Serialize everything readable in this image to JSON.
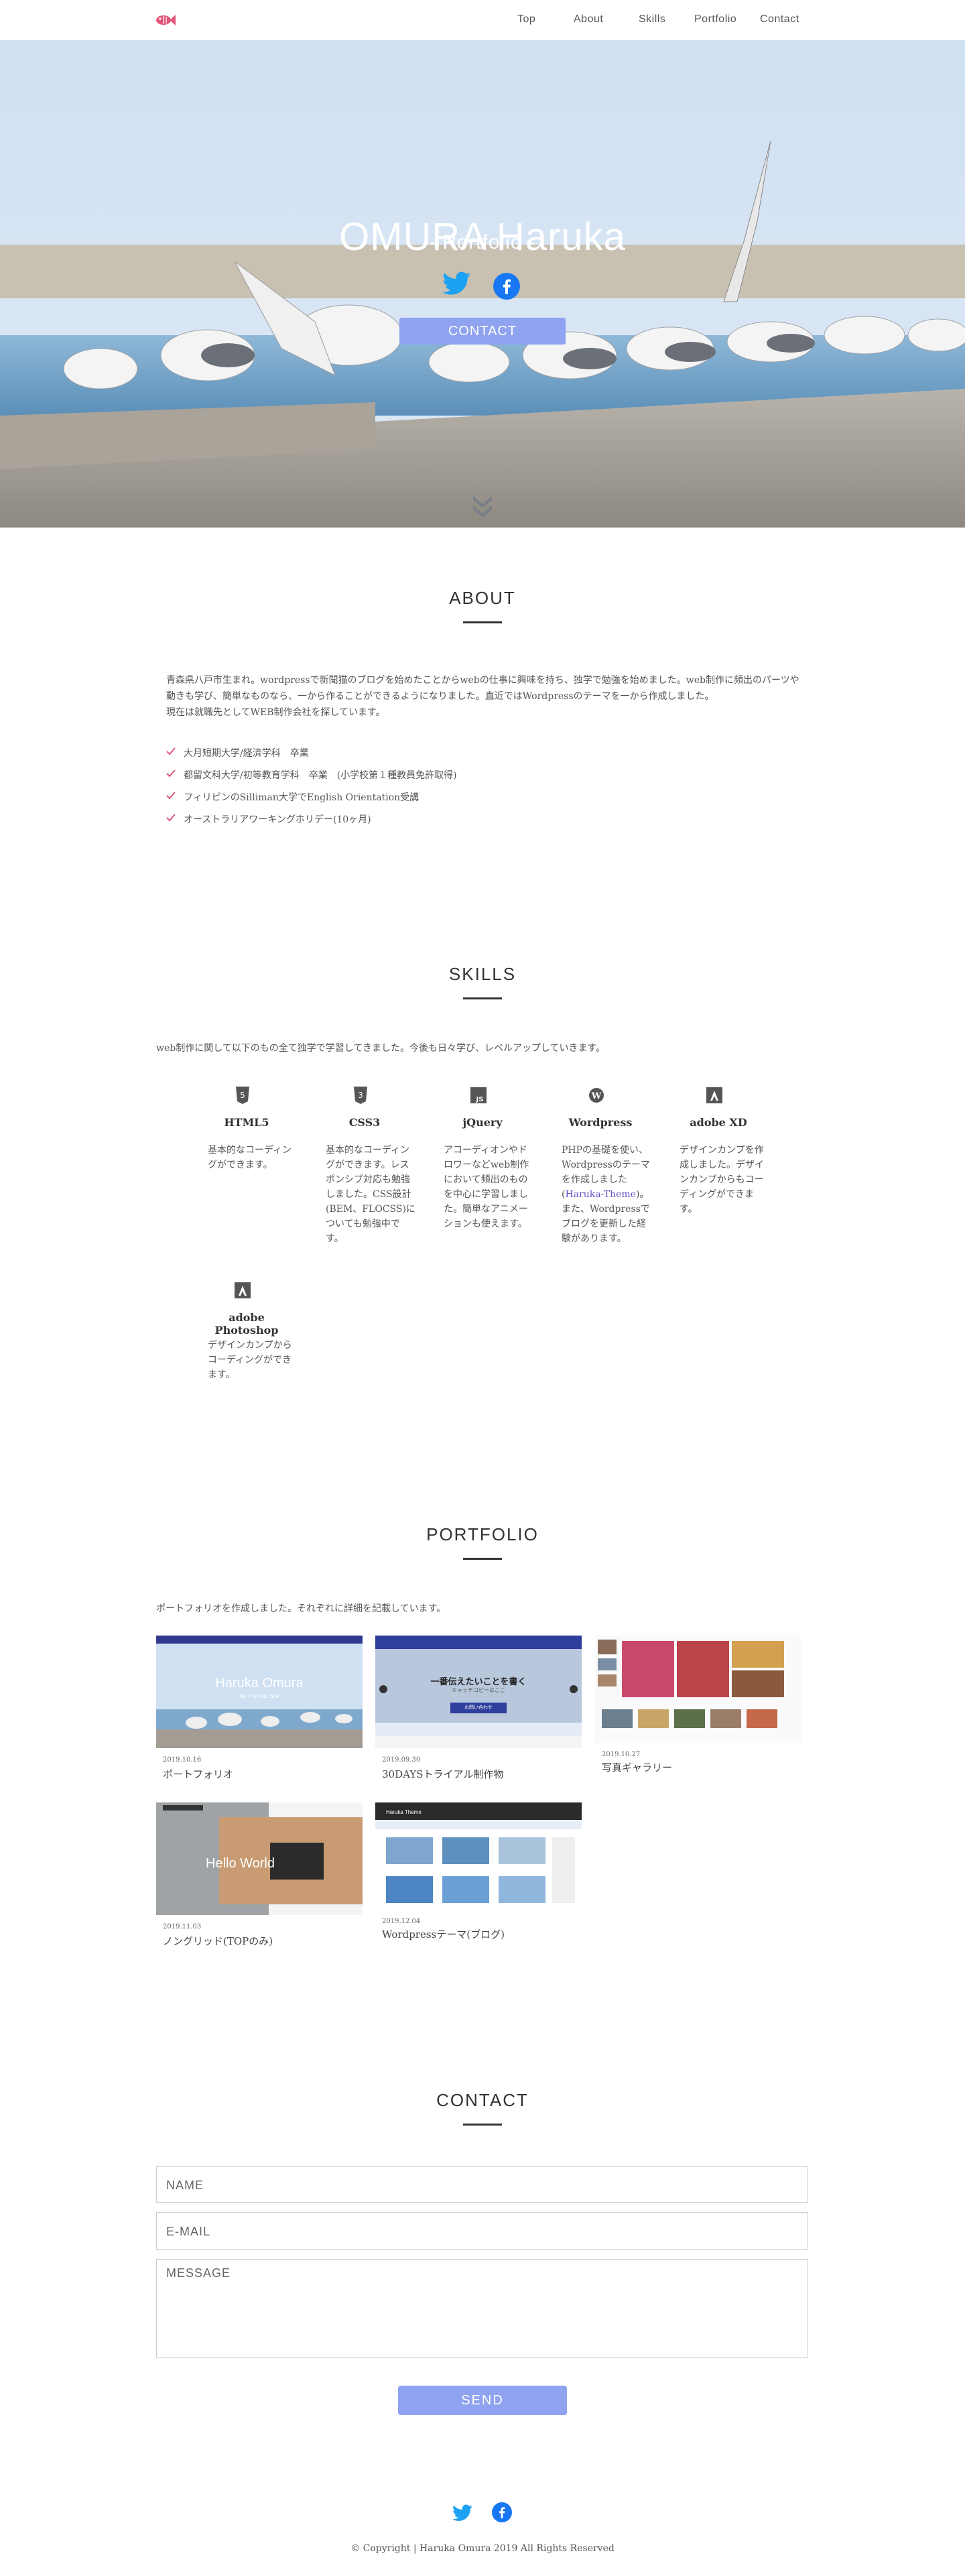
{
  "header": {
    "logo": "fish-logo",
    "nav": [
      "Top",
      "About",
      "Skills",
      "Portfolio",
      "Contact"
    ]
  },
  "hero": {
    "title": "OMURA Haruka",
    "subtitle": "- Portfolio -",
    "contact_button": "CONTACT"
  },
  "about": {
    "heading": "ABOUT",
    "paragraph": "青森県八戸市生まれ。wordpressで新聞猫のブログを始めたことからwebの仕事に興味を持ち、独学で勉強を始めました。web制作に頻出のパーツや動きも学び、簡単なものなら、一から作ることができるようになりました。直近ではWordpressのテーマを一から作成しました。",
    "paragraph2": "現在は就職先としてWEB制作会社を探しています。",
    "items": [
      "大月短期大学/経済学科　卒業",
      "都留文科大学/初等教育学科　卒業　(小学校第１種教員免許取得)",
      "フィリピンのSilliman大学でEnglish Orientation受講",
      "オーストラリアワーキングホリデー(10ヶ月)"
    ],
    "check_color": "#e2587a"
  },
  "skills": {
    "heading": "SKILLS",
    "intro": "web制作に関して以下のもの全て独学で学習してきました。今後も日々学び、レベルアップしていきます。",
    "items": [
      {
        "name": "HTML5",
        "icon": "html5-icon",
        "desc": "基本的なコーディングができます。"
      },
      {
        "name": "CSS3",
        "icon": "css3-icon",
        "desc": "基本的なコーディングができます。レスポンシブ対応も勉強しました。CSS設計(BEM、FLOCSS)についても勉強中です。"
      },
      {
        "name": "jQuery",
        "icon": "js-icon",
        "desc": "アコーディオンやドロワーなどweb制作において頻出のものを中心に学習しました。簡単なアニメーションも使えます。"
      },
      {
        "name": "Wordpress",
        "icon": "wordpress-icon",
        "desc_a": "PHPの基礎を使い、Wordpressのテーマを作成しました(",
        "desc_link": "Haruka-Theme",
        "desc_b": ")。また、Wordpressでブログを更新した経験があります。"
      },
      {
        "name": "adobe XD",
        "icon": "adobe-icon",
        "desc": "デザインカンプを作成しました。デザインカンプからもコーディングができます。"
      },
      {
        "name": "adobe Photoshop",
        "icon": "adobe-icon",
        "desc": "デザインカンプからコーディングができます。"
      }
    ]
  },
  "portfolio": {
    "heading": "PORTFOLIO",
    "intro": "ポートフォリオを作成しました。それぞれに詳細を記載しています。",
    "items": [
      {
        "date": "2019.10.16",
        "title": "ポートフォリオ",
        "thumb_title": "Haruka Omura",
        "thumb_sub": "- My Portfolio Site -"
      },
      {
        "date": "2019.09.30",
        "title": "30DAYSトライアル制作物",
        "thumb_title": "一番伝えたいことを書く",
        "thumb_sub": "キャッチコピーはここ",
        "thumb_btn": "お問い合わせ"
      },
      {
        "date": "2019.10.27",
        "title": "写真ギャラリー"
      },
      {
        "date": "2019.11.03",
        "title": "ノングリッド(TOPのみ)",
        "thumb_title": "Hello World"
      },
      {
        "date": "2019.12.04",
        "title": "Wordpressテーマ(ブログ)",
        "thumb_title": "Haruka Theme"
      }
    ]
  },
  "contact": {
    "heading": "CONTACT",
    "name_placeholder": "NAME",
    "email_placeholder": "E-MAIL",
    "message_placeholder": "MESSAGE",
    "send": "SEND"
  },
  "footer": {
    "copyright": "© Copyright | Haruka Omura 2019 All Rights Reserved"
  },
  "colors": {
    "accent": "#8fa3f0",
    "twitter": "#1da1f2",
    "facebook": "#1877f2",
    "logo": "#e2587a"
  }
}
